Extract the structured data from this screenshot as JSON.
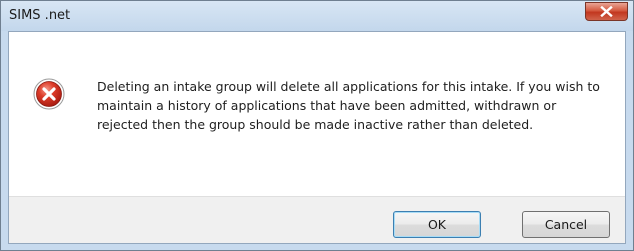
{
  "window": {
    "title": "SIMS .net",
    "close_icon": "close-icon"
  },
  "dialog": {
    "icon": "error-icon",
    "message": "Deleting an intake group will delete all applications for this intake. If you wish to maintain a history of applications that have been admitted, withdrawn or rejected then the group should be made inactive rather than deleted."
  },
  "buttons": {
    "ok_label": "OK",
    "cancel_label": "Cancel"
  },
  "colors": {
    "error_red": "#c8261a",
    "close_red": "#c7452b",
    "title_bar": "#c7daee",
    "focus_border": "#3c7fb1"
  }
}
